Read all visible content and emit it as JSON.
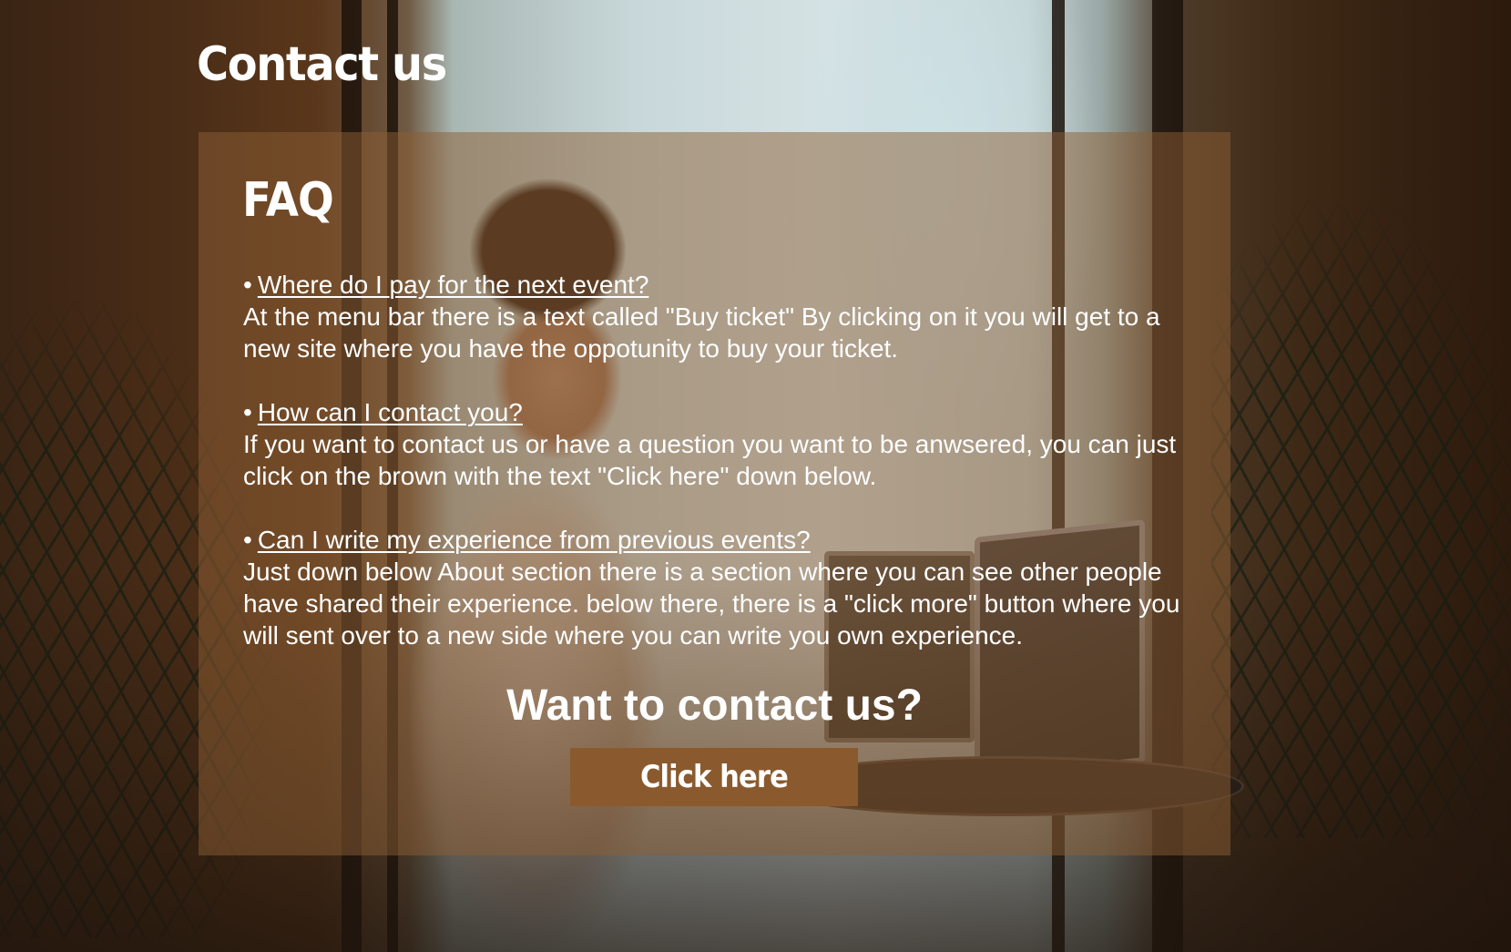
{
  "page": {
    "title": "Contact us"
  },
  "faq": {
    "heading": "FAQ",
    "bullet": "•",
    "items": [
      {
        "question": "Where do I pay for the next event?",
        "answer": "At the menu bar there is a text called \"Buy ticket\" By clicking on it you will get to a new site where you have the oppotunity to buy your ticket."
      },
      {
        "question": "How can I contact you?",
        "answer": "If you want to contact us or have a question you want to be anwsered, you can just click on the brown with the text \"Click here\" down below."
      },
      {
        "question": "Can I write my experience from previous events?",
        "answer": "Just down below About section there is a section where you can see other people have shared their experience. below there, there is a \"click more\" button where you will sent over to a new side where you can write you own experience."
      }
    ]
  },
  "contact": {
    "heading": "Want to contact us?",
    "button_label": "Click here"
  },
  "colors": {
    "panel_overlay": "#8b5e34",
    "button": "#8a5a2e",
    "text": "#ffffff"
  }
}
